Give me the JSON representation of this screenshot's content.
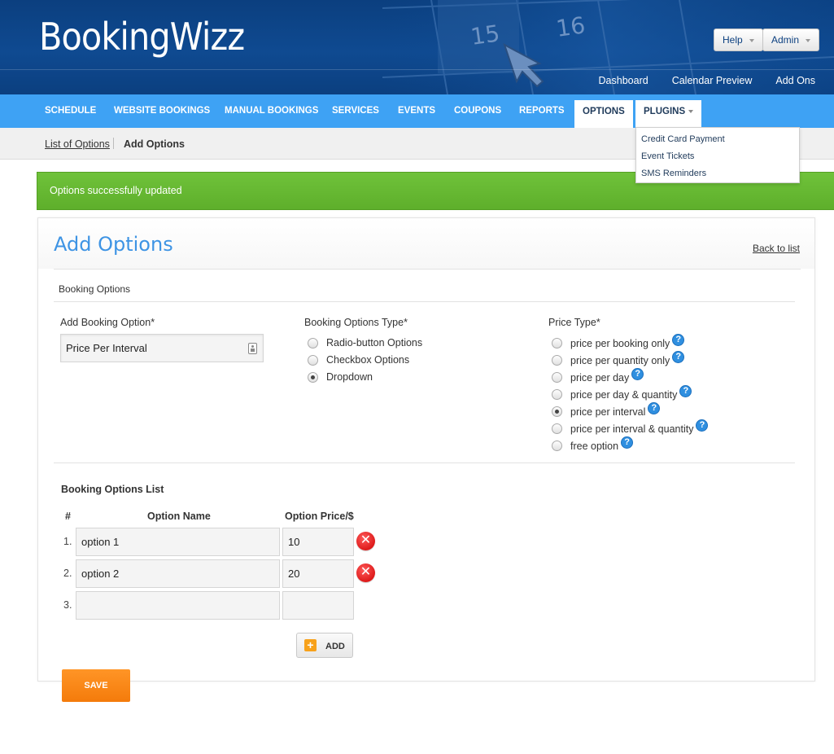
{
  "brand": {
    "name": "BookingWizz"
  },
  "header": {
    "help_label": "Help",
    "admin_label": "Admin",
    "links": [
      "Dashboard",
      "Calendar Preview",
      "Add Ons"
    ],
    "art_numbers": [
      "15",
      "16"
    ]
  },
  "nav": {
    "items": [
      "SCHEDULE",
      "WEBSITE BOOKINGS",
      "MANUAL BOOKINGS",
      "SERVICES",
      "EVENTS",
      "COUPONS",
      "REPORTS",
      "OPTIONS",
      "PLUGINS"
    ],
    "active": "OPTIONS"
  },
  "plugins_menu": [
    "Credit Card Payment",
    "Event Tickets",
    "SMS Reminders"
  ],
  "breadcrumb": {
    "parent": "List of Options",
    "current": "Add Options"
  },
  "alert": {
    "message": "Options successfully updated",
    "color": "#64b632"
  },
  "panel": {
    "title": "Add Options",
    "back_link": "Back to list",
    "section_label": "Booking Options",
    "add_option_label": "Add Booking Option*",
    "add_option_value": "Price Per Interval",
    "type_label": "Booking Options Type*",
    "types": [
      {
        "label": "Radio-button Options",
        "checked": false
      },
      {
        "label": "Checkbox Options",
        "checked": false
      },
      {
        "label": "Dropdown",
        "checked": true
      }
    ],
    "price_type_label": "Price Type*",
    "price_types": [
      {
        "label": "price per booking only",
        "checked": false
      },
      {
        "label": "price per quantity only",
        "checked": false
      },
      {
        "label": "price per day",
        "checked": false
      },
      {
        "label": "price per day & quantity",
        "checked": false
      },
      {
        "label": "price per interval",
        "checked": true
      },
      {
        "label": "price per interval & quantity",
        "checked": false
      },
      {
        "label": "free option",
        "checked": false
      }
    ],
    "list_label": "Booking Options List",
    "col_hash": "#",
    "col_name": "Option Name",
    "col_price": "Option Price/$",
    "rows": [
      {
        "num": "1.",
        "name": "option 1",
        "price": "10"
      },
      {
        "num": "2.",
        "name": "option 2",
        "price": "20"
      },
      {
        "num": "3.",
        "name": "",
        "price": ""
      }
    ],
    "add_label": "ADD",
    "save_label": "SAVE"
  }
}
